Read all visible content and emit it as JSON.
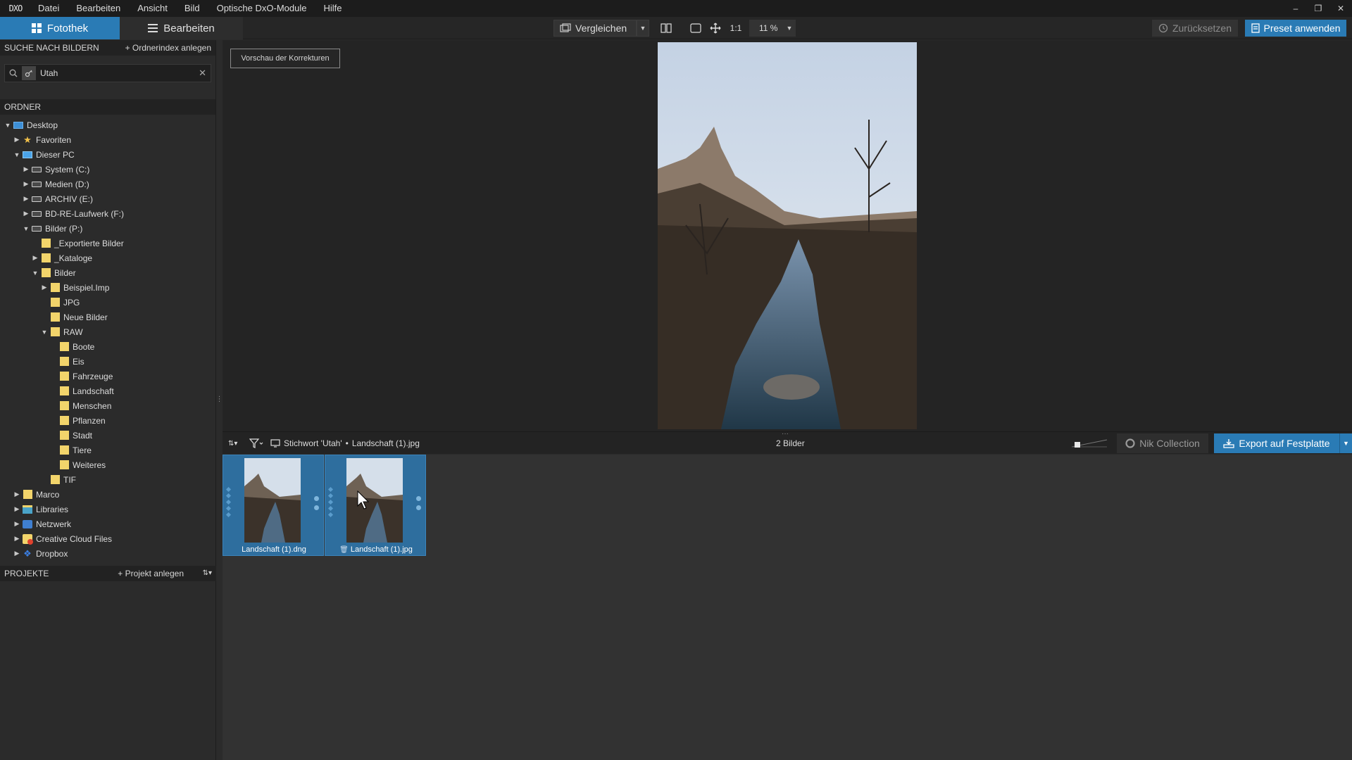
{
  "app": {
    "logo": "DXO",
    "menu": [
      "Datei",
      "Bearbeiten",
      "Ansicht",
      "Bild",
      "Optische DxO-Module",
      "Hilfe"
    ],
    "window_controls": [
      "–",
      "❐",
      "✕"
    ]
  },
  "toolbar": {
    "tab_library": "Fotothek",
    "tab_edit": "Bearbeiten",
    "compare_label": "Vergleichen",
    "zoom_one_to_one": "1:1",
    "zoom_level": "11 %",
    "reset_label": "Zurücksetzen",
    "preset_label": "Preset anwenden"
  },
  "search": {
    "header": "SUCHE NACH BILDERN",
    "action": "+ Ordnerindex anlegen",
    "value": "Utah"
  },
  "folders": {
    "header": "ORDNER",
    "items": [
      {
        "label": "Desktop",
        "depth": 0,
        "toggle": "open",
        "icon": "desktop"
      },
      {
        "label": "Favoriten",
        "depth": 1,
        "toggle": "closed",
        "icon": "star"
      },
      {
        "label": "Dieser PC",
        "depth": 1,
        "toggle": "open",
        "icon": "pc"
      },
      {
        "label": "System (C:)",
        "depth": 2,
        "toggle": "closed",
        "icon": "drive"
      },
      {
        "label": "Medien (D:)",
        "depth": 2,
        "toggle": "closed",
        "icon": "drive"
      },
      {
        "label": "ARCHIV (E:)",
        "depth": 2,
        "toggle": "closed",
        "icon": "drive"
      },
      {
        "label": "BD-RE-Laufwerk (F:)",
        "depth": 2,
        "toggle": "closed",
        "icon": "drive"
      },
      {
        "label": "Bilder (P:)",
        "depth": 2,
        "toggle": "open",
        "icon": "drive"
      },
      {
        "label": "_Exportierte Bilder",
        "depth": 3,
        "toggle": "none",
        "icon": "folder"
      },
      {
        "label": "_Kataloge",
        "depth": 3,
        "toggle": "closed",
        "icon": "folder"
      },
      {
        "label": "Bilder",
        "depth": 3,
        "toggle": "open",
        "icon": "folder"
      },
      {
        "label": "Beispiel.Imp",
        "depth": 4,
        "toggle": "closed",
        "icon": "folder"
      },
      {
        "label": "JPG",
        "depth": 4,
        "toggle": "none",
        "icon": "folder"
      },
      {
        "label": "Neue Bilder",
        "depth": 4,
        "toggle": "none",
        "icon": "folder"
      },
      {
        "label": "RAW",
        "depth": 4,
        "toggle": "open",
        "icon": "folder"
      },
      {
        "label": "Boote",
        "depth": 5,
        "toggle": "none",
        "icon": "folder"
      },
      {
        "label": "Eis",
        "depth": 5,
        "toggle": "none",
        "icon": "folder"
      },
      {
        "label": "Fahrzeuge",
        "depth": 5,
        "toggle": "none",
        "icon": "folder"
      },
      {
        "label": "Landschaft",
        "depth": 5,
        "toggle": "none",
        "icon": "folder"
      },
      {
        "label": "Menschen",
        "depth": 5,
        "toggle": "none",
        "icon": "folder"
      },
      {
        "label": "Pflanzen",
        "depth": 5,
        "toggle": "none",
        "icon": "folder"
      },
      {
        "label": "Stadt",
        "depth": 5,
        "toggle": "none",
        "icon": "folder"
      },
      {
        "label": "Tiere",
        "depth": 5,
        "toggle": "none",
        "icon": "folder"
      },
      {
        "label": "Weiteres",
        "depth": 5,
        "toggle": "none",
        "icon": "folder"
      },
      {
        "label": "TIF",
        "depth": 4,
        "toggle": "none",
        "icon": "folder"
      },
      {
        "label": "Marco",
        "depth": 1,
        "toggle": "closed",
        "icon": "folder"
      },
      {
        "label": "Libraries",
        "depth": 1,
        "toggle": "closed",
        "icon": "libraries"
      },
      {
        "label": "Netzwerk",
        "depth": 1,
        "toggle": "closed",
        "icon": "network"
      },
      {
        "label": "Creative Cloud Files",
        "depth": 1,
        "toggle": "closed",
        "icon": "creative-cloud"
      },
      {
        "label": "Dropbox",
        "depth": 1,
        "toggle": "closed",
        "icon": "dropbox"
      }
    ]
  },
  "projects": {
    "header": "PROJEKTE",
    "action": "+ Projekt anlegen"
  },
  "viewer": {
    "preview_button": "Vorschau der Korrekturen"
  },
  "filmstrip": {
    "breadcrumb_keyword": "Stichwort 'Utah'",
    "breadcrumb_separator": "•",
    "breadcrumb_file": "Landschaft (1).jpg",
    "count": "2 Bilder",
    "nik_label": "Nik Collection",
    "export_label": "Export auf Festplatte",
    "thumbnails": [
      {
        "label": "Landschaft (1).dng"
      },
      {
        "label": "Landschaft (1).jpg"
      }
    ]
  },
  "colors": {
    "accent": "#2a7bb5",
    "panel": "#2b2b2b",
    "menubar": "#1c1c1c",
    "folder": "#f2d46b"
  }
}
